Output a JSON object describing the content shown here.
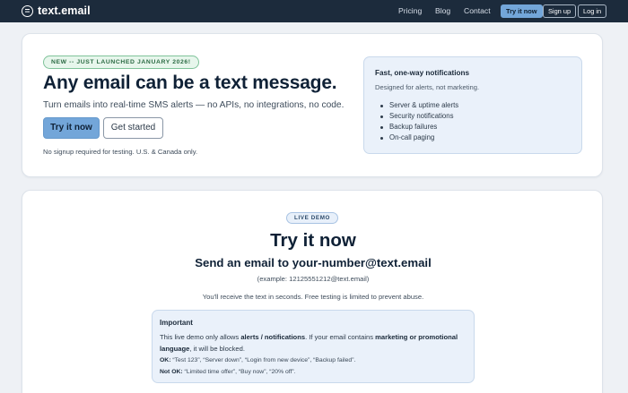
{
  "nav": {
    "brand": "text.email",
    "links": [
      "Pricing",
      "Blog",
      "Contact"
    ],
    "try_label": "Try it now",
    "signup_label": "Sign up",
    "login_label": "Log in"
  },
  "hero": {
    "badge": "NEW -- JUST LAUNCHED JANUARY 2026!",
    "title": "Any email can be a text message.",
    "subtitle": "Turn emails into real-time SMS alerts — no APIs, no integrations, no code.",
    "primary_button": "Try it now",
    "secondary_button": "Get started",
    "note": "No signup required for testing. U.S. & Canada only."
  },
  "features": {
    "title": "Fast, one-way notifications",
    "subtitle": "Designed for alerts, not marketing.",
    "items": [
      "Server & uptime alerts",
      "Security notifications",
      "Backup failures",
      "On-call paging"
    ]
  },
  "demo": {
    "badge": "LIVE DEMO",
    "title": "Try it now",
    "subtitle": "Send an email to your-number@text.email",
    "example": "(example: 12125551212@text.email)",
    "note": "You'll receive the text in seconds. Free testing is limited to prevent abuse.",
    "important": {
      "title": "Important",
      "body_1": "This live demo only allows ",
      "body_bold_1": "alerts / notifications",
      "body_2": ". If your email contains ",
      "body_bold_2": "marketing or promotional language",
      "body_3": ", it will be blocked.",
      "ok_label": "OK:",
      "ok_text": " “Test 123”, “Server down”, “Login from new device”, “Backup failed”.",
      "notok_label": "Not OK:",
      "notok_text": " “Limited time offer”, “Buy now”, “20% off”."
    }
  },
  "colors": {
    "nav_bg": "#1c2b3c",
    "accent": "#73a6d9",
    "panel_bg": "#eaf1fa",
    "new_badge_bg": "#e7f6ec"
  }
}
